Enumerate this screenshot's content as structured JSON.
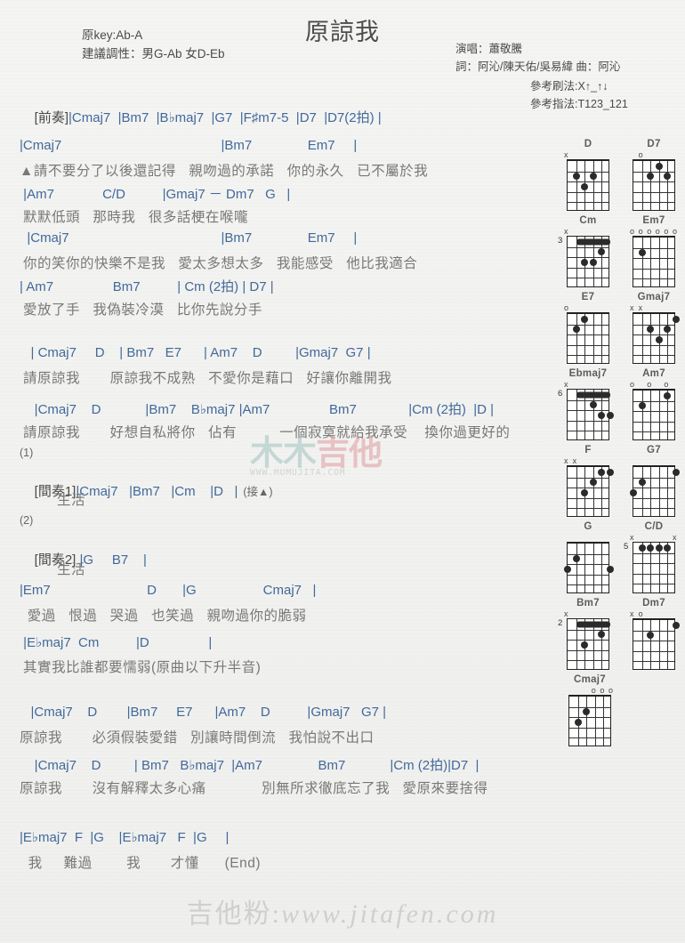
{
  "header": {
    "title": "原諒我",
    "original_key": "原key:Ab-A",
    "suggested_key": "建議調性：男G-Ab 女D-Eb",
    "singer": "演唱：蕭敬騰",
    "credits": "詞：阿沁/陳天佑/吳易緯  曲：阿沁",
    "strum_pattern": "參考刷法:X↑_↑↓",
    "picking_pattern": "參考指法:T123_121",
    "intro_label": "[前奏]",
    "intro_chords": "|Cmaj7  |Bm7  |B♭maj7  |G7  |F♯m7-5  |D7  |D7(2拍) |"
  },
  "sections": [
    {
      "chords": "|Cmaj7                                           |Bm7               Em7     |",
      "lyrics": "▲請不要分了以後還記得   親吻過的承諾   你的永久   已不屬於我"
    },
    {
      "chords": " |Am7             C/D          |Gmaj7 － Dm7   G   |",
      "lyrics": "默默低頭   那時我   很多話梗在喉嚨"
    },
    {
      "chords": "  |Cmaj7                                         |Bm7               Em7     |",
      "lyrics": "你的笑你的快樂不是我   愛太多想太多   我能感受   他比我適合"
    },
    {
      "chords": "| Am7                Bm7          | Cm (2拍) | D7 |",
      "lyrics": "愛放了手   我偽裝冷漠   比你先說分手"
    },
    {
      "chords": "   | Cmaj7     D    | Bm7   E7      | Am7    D         |Gmaj7  G7 |",
      "lyrics": "請原諒我       原諒我不成熟   不愛你是藉口   好讓你離開我"
    },
    {
      "chords": "    |Cmaj7    D            |Bm7    B♭maj7 |Am7                Bm7              |Cm (2拍)  |D |",
      "lyrics": "請原諒我       好想自私將你   佔有          一個寂寞就給我承受    換你過更好的"
    }
  ],
  "interlude1": {
    "ending_number": "(1)",
    "label": "[間奏1]",
    "chords": "|Cmaj7   |Bm7   |Cm    |D   |",
    "note": "(接▲)",
    "lyric": "生活"
  },
  "interlude2": {
    "ending_number": "(2)",
    "label": "[間奏2]",
    "chords": " |G     B7    |",
    "lyric": "生活"
  },
  "bridge": [
    {
      "chords": "|Em7                          D       |G                  Cmaj7   |",
      "lyrics": " 愛過   恨過   哭過   也笑過   親吻過你的脆弱"
    },
    {
      "chords": " |E♭maj7  Cm          |D                |",
      "lyrics": "其實我比誰都要懦弱(原曲以下升半音)"
    }
  ],
  "final": [
    {
      "chords": "   |Cmaj7    D        |Bm7     E7      |Am7    D          |Gmaj7   G7 |",
      "lyrics": "原諒我       必須假裝愛錯   別讓時間倒流   我怕說不出口"
    },
    {
      "chords": "    |Cmaj7    D         | Bm7   B♭maj7  |Am7               Bm7            |Cm (2拍)|D7  |",
      "lyrics": "原諒我       沒有解釋太多心痛             別無所求徹底忘了我   愛原來要捨得"
    },
    {
      "chords": "|E♭maj7  F  |G    |E♭maj7   F  |G     |",
      "lyrics": "  我     難過        我       才懂      (End)"
    }
  ],
  "chord_diagrams": [
    {
      "name": "D",
      "open_marks": [
        "x",
        "",
        "",
        "",
        "",
        ""
      ],
      "start_fret": "",
      "dots": [
        [
          5,
          2
        ],
        [
          4,
          3
        ],
        [
          3,
          2
        ]
      ]
    },
    {
      "name": "D7",
      "open_marks": [
        "",
        "o",
        "",
        "",
        "",
        ""
      ],
      "start_fret": "",
      "dots": [
        [
          4,
          2
        ],
        [
          3,
          1
        ],
        [
          2,
          2
        ]
      ]
    },
    {
      "name": "Cm",
      "open_marks": [
        "x",
        "",
        "",
        "",
        "",
        ""
      ],
      "start_fret": "3",
      "barre": {
        "fret": 1,
        "from": 5,
        "to": 1
      },
      "dots": [
        [
          4,
          3
        ],
        [
          3,
          3
        ],
        [
          2,
          2
        ]
      ]
    },
    {
      "name": "Em7",
      "open_marks": [
        "o",
        "o",
        "o",
        "o",
        "o",
        "o"
      ],
      "start_fret": "",
      "dots": [
        [
          5,
          2
        ]
      ]
    },
    {
      "name": "E7",
      "open_marks": [
        "o",
        "",
        "",
        "",
        "",
        ""
      ],
      "start_fret": "",
      "dots": [
        [
          5,
          2
        ],
        [
          4,
          1
        ]
      ]
    },
    {
      "name": "Gmaj7",
      "open_marks": [
        "x",
        "x",
        "",
        "",
        "",
        ""
      ],
      "start_fret": "",
      "dots": [
        [
          4,
          2
        ],
        [
          3,
          3
        ],
        [
          2,
          2
        ],
        [
          1,
          1
        ]
      ]
    },
    {
      "name": "Ebmaj7",
      "open_marks": [
        "x",
        "",
        "",
        "",
        "",
        ""
      ],
      "start_fret": "6",
      "barre": {
        "fret": 1,
        "from": 5,
        "to": 1
      },
      "dots": [
        [
          3,
          2
        ],
        [
          2,
          3
        ],
        [
          1,
          3
        ]
      ]
    },
    {
      "name": "Am7",
      "open_marks": [
        "o",
        "",
        "o",
        "",
        "o",
        ""
      ],
      "start_fret": "",
      "dots": [
        [
          5,
          2
        ],
        [
          2,
          1
        ]
      ]
    },
    {
      "name": "F",
      "open_marks": [
        "x",
        "x",
        "",
        "",
        "",
        ""
      ],
      "start_fret": "",
      "dots": [
        [
          4,
          3
        ],
        [
          3,
          2
        ],
        [
          2,
          1
        ],
        [
          1,
          1
        ]
      ]
    },
    {
      "name": "G7",
      "open_marks": [
        "",
        "",
        "",
        "",
        "",
        ""
      ],
      "start_fret": "",
      "dots": [
        [
          6,
          3
        ],
        [
          5,
          2
        ],
        [
          1,
          1
        ]
      ]
    },
    {
      "name": "G",
      "open_marks": [
        "",
        "",
        "",
        "",
        "",
        ""
      ],
      "start_fret": "",
      "dots": [
        [
          6,
          3
        ],
        [
          5,
          2
        ],
        [
          1,
          3
        ]
      ]
    },
    {
      "name": "C/D",
      "open_marks": [
        "x",
        "",
        "",
        "",
        "",
        "x"
      ],
      "start_fret": "5",
      "dots": [
        [
          5,
          1
        ],
        [
          4,
          1
        ],
        [
          3,
          1
        ],
        [
          2,
          1
        ]
      ]
    },
    {
      "name": "Bm7",
      "open_marks": [
        "x",
        "",
        "",
        "",
        "",
        ""
      ],
      "start_fret": "2",
      "barre": {
        "fret": 1,
        "from": 5,
        "to": 1
      },
      "dots": [
        [
          4,
          3
        ],
        [
          2,
          2
        ]
      ]
    },
    {
      "name": "Dm7",
      "open_marks": [
        "x",
        "o",
        "",
        "",
        "",
        ""
      ],
      "start_fret": "",
      "dots": [
        [
          4,
          2
        ],
        [
          1,
          1
        ]
      ]
    },
    {
      "name": "Cmaj7",
      "open_marks": [
        "",
        "",
        "",
        "o",
        "o",
        "o"
      ],
      "start_fret": "",
      "dots": [
        [
          5,
          3
        ],
        [
          4,
          2
        ]
      ]
    }
  ],
  "watermark": {
    "center_part1": "木木",
    "center_part2": "吉他",
    "center_url": "WWW.MUMUJITA.COM",
    "bottom_cn": "吉他粉:",
    "bottom_url": "www.jitafen.com"
  }
}
